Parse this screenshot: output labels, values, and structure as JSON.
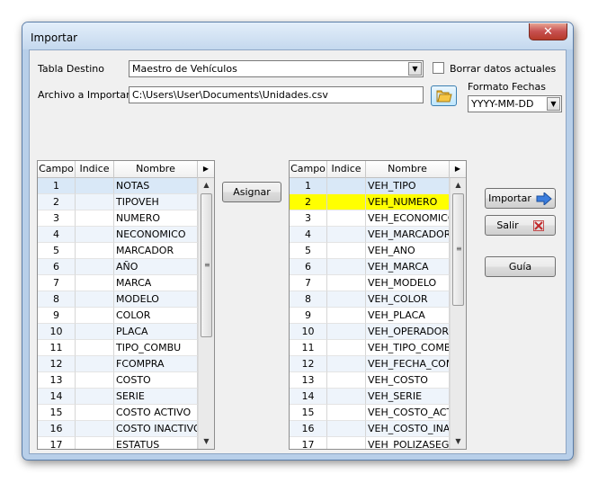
{
  "window": {
    "title": "Importar",
    "close_label": "✕"
  },
  "form": {
    "tabla_destino_label": "Tabla Destino",
    "tabla_destino_value": "Maestro de Vehículos",
    "borrar_label": "Borrar datos actuales",
    "borrar_checked": false,
    "archivo_label": "Archivo a Importar",
    "archivo_value": "C:\\Users\\User\\Documents\\Unidades.csv",
    "formato_label": "Formato Fechas",
    "formato_value": "YYYY-MM-DD"
  },
  "buttons": {
    "asignar": "Asignar",
    "importar": "Importar",
    "salir": "Salir",
    "guia": "Guía"
  },
  "grid_headers": {
    "campo": "Campo",
    "indice": "Indice",
    "nombre": "Nombre"
  },
  "left_grid": {
    "rows": [
      {
        "campo": "1",
        "indice": "",
        "nombre": "NOTAS"
      },
      {
        "campo": "2",
        "indice": "",
        "nombre": "TIPOVEH"
      },
      {
        "campo": "3",
        "indice": "",
        "nombre": "NUMERO"
      },
      {
        "campo": "4",
        "indice": "",
        "nombre": "NECONOMICO"
      },
      {
        "campo": "5",
        "indice": "",
        "nombre": "MARCADOR"
      },
      {
        "campo": "6",
        "indice": "",
        "nombre": "AÑO"
      },
      {
        "campo": "7",
        "indice": "",
        "nombre": "MARCA"
      },
      {
        "campo": "8",
        "indice": "",
        "nombre": "MODELO"
      },
      {
        "campo": "9",
        "indice": "",
        "nombre": "COLOR"
      },
      {
        "campo": "10",
        "indice": "",
        "nombre": "PLACA"
      },
      {
        "campo": "11",
        "indice": "",
        "nombre": "TIPO_COMBU"
      },
      {
        "campo": "12",
        "indice": "",
        "nombre": "FCOMPRA"
      },
      {
        "campo": "13",
        "indice": "",
        "nombre": "COSTO"
      },
      {
        "campo": "14",
        "indice": "",
        "nombre": "SERIE"
      },
      {
        "campo": "15",
        "indice": "",
        "nombre": "COSTO ACTIVO"
      },
      {
        "campo": "16",
        "indice": "",
        "nombre": "COSTO INACTIVO"
      },
      {
        "campo": "17",
        "indice": "",
        "nombre": "ESTATUS"
      }
    ]
  },
  "right_grid": {
    "rows": [
      {
        "campo": "1",
        "indice": "",
        "nombre": "VEH_TIPO"
      },
      {
        "campo": "2",
        "indice": "",
        "nombre": "VEH_NUMERO"
      },
      {
        "campo": "3",
        "indice": "",
        "nombre": "VEH_ECONOMICO"
      },
      {
        "campo": "4",
        "indice": "",
        "nombre": "VEH_MARCADOR"
      },
      {
        "campo": "5",
        "indice": "",
        "nombre": "VEH_ANO"
      },
      {
        "campo": "6",
        "indice": "",
        "nombre": "VEH_MARCA"
      },
      {
        "campo": "7",
        "indice": "",
        "nombre": "VEH_MODELO"
      },
      {
        "campo": "8",
        "indice": "",
        "nombre": "VEH_COLOR"
      },
      {
        "campo": "9",
        "indice": "",
        "nombre": "VEH_PLACA"
      },
      {
        "campo": "10",
        "indice": "",
        "nombre": "VEH_OPERADOR"
      },
      {
        "campo": "11",
        "indice": "",
        "nombre": "VEH_TIPO_COMBU"
      },
      {
        "campo": "12",
        "indice": "",
        "nombre": "VEH_FECHA_COMPRA"
      },
      {
        "campo": "13",
        "indice": "",
        "nombre": "VEH_COSTO"
      },
      {
        "campo": "14",
        "indice": "",
        "nombre": "VEH_SERIE"
      },
      {
        "campo": "15",
        "indice": "",
        "nombre": "VEH_COSTO_ACTIVO"
      },
      {
        "campo": "16",
        "indice": "",
        "nombre": "VEH_COSTO_INACTIVO"
      },
      {
        "campo": "17",
        "indice": "",
        "nombre": "VEH_POLIZASEGURO"
      }
    ]
  },
  "colors": {
    "selected_row": "#d9e8f7",
    "highlight_row": "#ffff00",
    "alt_row": "#eef4fb",
    "row": "#ffffff"
  }
}
